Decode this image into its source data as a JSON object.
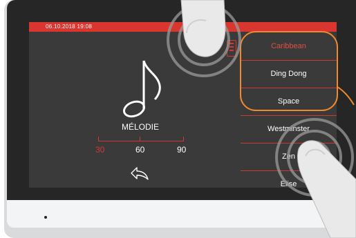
{
  "status_bar": {
    "datetime": "06.10.2018  19:08"
  },
  "setting": {
    "label": "MÉLODIE",
    "volume_levels": [
      "30",
      "60",
      "90"
    ],
    "selected_volume": "30",
    "icon": "music-note-icon",
    "back_icon": "back-arrow-icon"
  },
  "melody_menu": {
    "items": [
      {
        "label": "Caribbean",
        "selected": true
      },
      {
        "label": "Ding Dong",
        "selected": false
      },
      {
        "label": "Space",
        "selected": false
      },
      {
        "label": "Westminster",
        "selected": false
      },
      {
        "label": "Zen",
        "selected": false
      },
      {
        "label": "Elise",
        "selected": false
      }
    ]
  },
  "colors": {
    "accent": "#d8362e",
    "highlight": "#f08a2c",
    "screen": "#3a3a3a"
  }
}
